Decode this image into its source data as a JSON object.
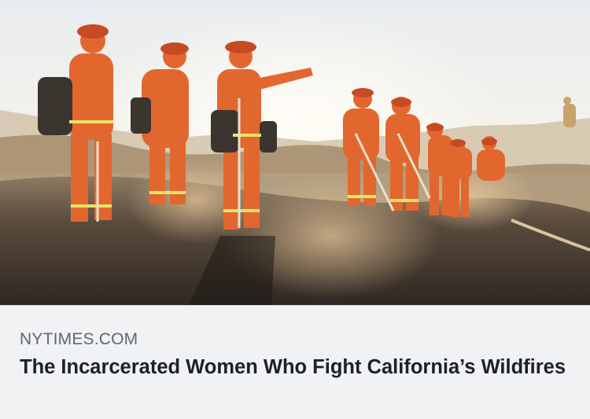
{
  "link_preview": {
    "image_description_icon": "article-photo",
    "domain": "NYTIMES.COM",
    "headline": "The Incarcerated Women Who Fight California’s Wildfires"
  },
  "colors": {
    "card_background": "#f1f2f4",
    "domain_text": "#606770",
    "headline_text": "#1d2129",
    "uniform_orange": "#e2672f"
  }
}
